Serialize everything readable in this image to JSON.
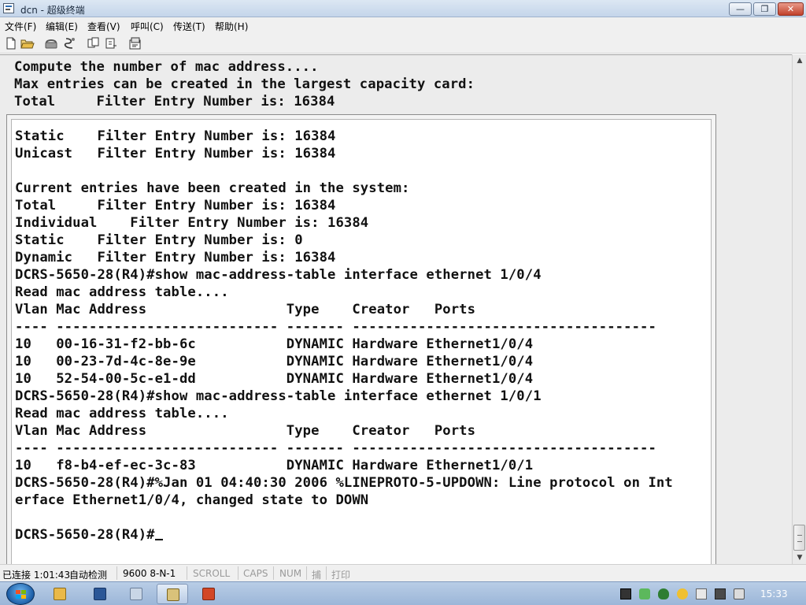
{
  "window": {
    "title": "dcn - 超级终端",
    "min_label": "—",
    "max_label": "❐",
    "close_label": "✕"
  },
  "menu": [
    {
      "label": "文件(F)"
    },
    {
      "label": "编辑(E)"
    },
    {
      "label": "查看(V)"
    },
    {
      "label": "呼叫(C)"
    },
    {
      "label": "传送(T)"
    },
    {
      "label": "帮助(H)"
    }
  ],
  "toolbar": {
    "buttons": [
      "new-document-icon",
      "open-folder-icon",
      "phone-call-icon",
      "disconnect-icon",
      "send-file-icon",
      "receive-file-icon",
      "properties-icon"
    ]
  },
  "terminal": {
    "top_lines": [
      "Compute the number of mac address....",
      "Max entries can be created in the largest capacity card:",
      "Total     Filter Entry Number is: 16384"
    ],
    "lines": [
      "Static    Filter Entry Number is: 16384",
      "Unicast   Filter Entry Number is: 16384",
      "",
      "Current entries have been created in the system:",
      "Total     Filter Entry Number is: 16384",
      "Individual    Filter Entry Number is: 16384",
      "Static    Filter Entry Number is: 0",
      "Dynamic   Filter Entry Number is: 16384",
      "DCRS-5650-28(R4)#show mac-address-table interface ethernet 1/0/4",
      "Read mac address table....",
      "Vlan Mac Address                 Type    Creator   Ports",
      "---- --------------------------- ------- -------------------------------------",
      "10   00-16-31-f2-bb-6c           DYNAMIC Hardware Ethernet1/0/4",
      "10   00-23-7d-4c-8e-9e           DYNAMIC Hardware Ethernet1/0/4",
      "10   52-54-00-5c-e1-dd           DYNAMIC Hardware Ethernet1/0/4",
      "DCRS-5650-28(R4)#show mac-address-table interface ethernet 1/0/1",
      "Read mac address table....",
      "Vlan Mac Address                 Type    Creator   Ports",
      "---- --------------------------- ------- -------------------------------------",
      "10   f8-b4-ef-ec-3c-83           DYNAMIC Hardware Ethernet1/0/1",
      "DCRS-5650-28(R4)#%Jan 01 04:40:30 2006 %LINEPROTO-5-UPDOWN: Line protocol on Int",
      "erface Ethernet1/0/4, changed state to DOWN",
      ""
    ],
    "prompt": "DCRS-5650-28(R4)#"
  },
  "statusbar": {
    "connection": "已连接 1:01:43",
    "detect": "自动检测",
    "settings": "9600 8-N-1",
    "scroll": "SCROLL",
    "caps": "CAPS",
    "num": "NUM",
    "capture": "捕",
    "print": "打印"
  },
  "taskbar": {
    "clock": "15:33"
  },
  "colors": {
    "terminal_bg": "#ffffff",
    "terminal_text": "#111111",
    "taskbar_bg": "#9cb6d8",
    "close_button": "#c1412b"
  }
}
